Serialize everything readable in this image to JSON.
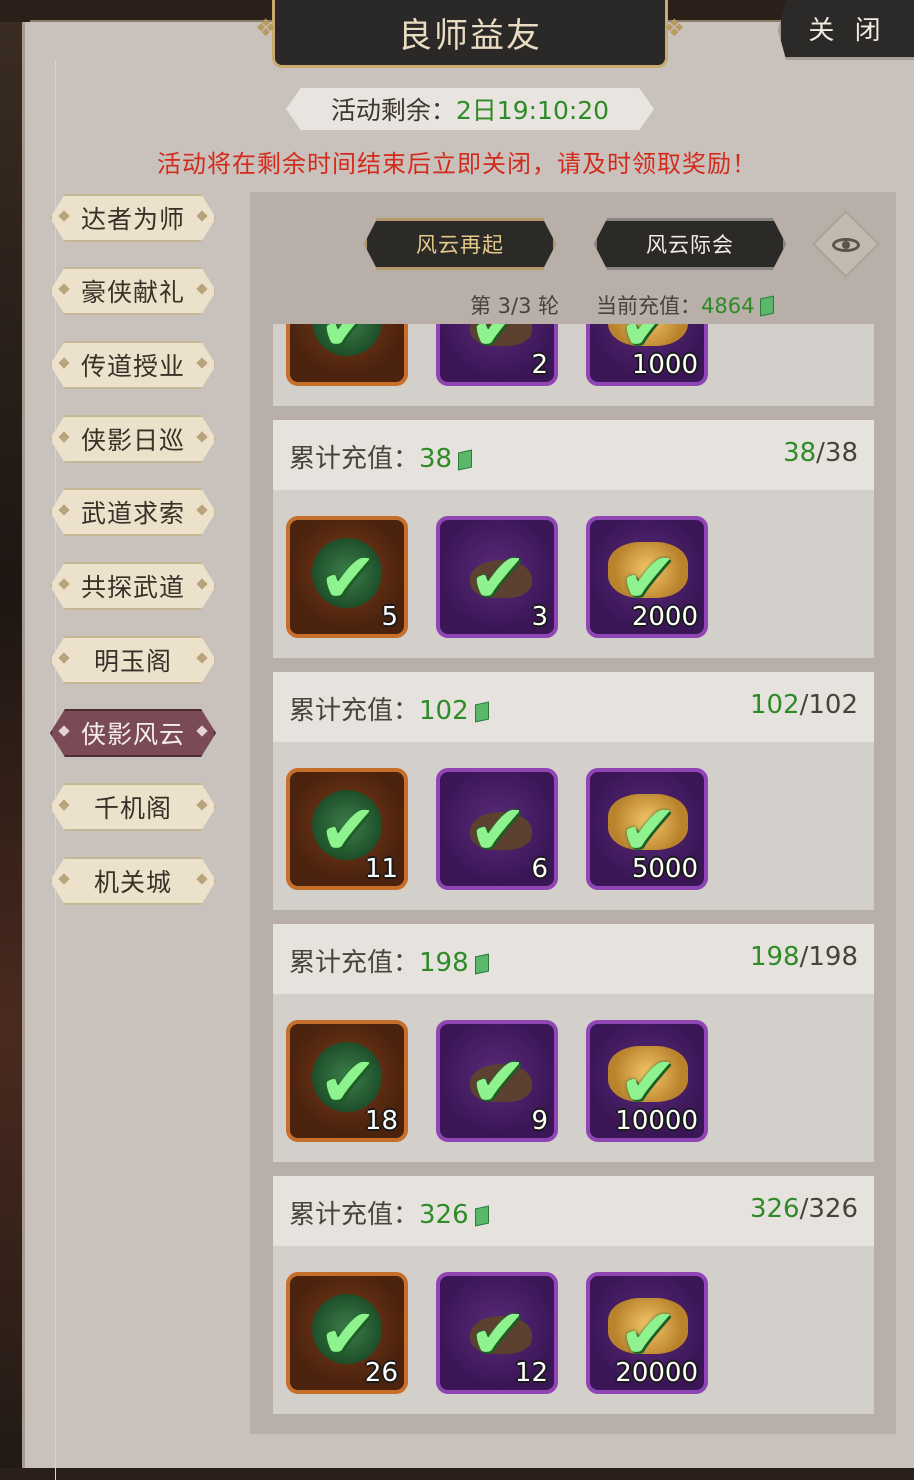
{
  "header": {
    "title": "良师益友",
    "close_label": "关 闭"
  },
  "timer": {
    "label": "活动剩余：",
    "value": "2日19:10:20"
  },
  "warning": "活动将在剩余时间结束后立即关闭，请及时领取奖励！",
  "sidebar": {
    "items": [
      {
        "label": "达者为师"
      },
      {
        "label": "豪侠献礼"
      },
      {
        "label": "传道授业"
      },
      {
        "label": "侠影日巡"
      },
      {
        "label": "武道求索"
      },
      {
        "label": "共探武道"
      },
      {
        "label": "明玉阁"
      },
      {
        "label": "侠影风云",
        "active": true
      },
      {
        "label": "千机阁"
      },
      {
        "label": "机关城"
      }
    ]
  },
  "tabs": [
    {
      "label": "风云再起",
      "active": true
    },
    {
      "label": "风云际会",
      "active": false
    }
  ],
  "status": {
    "round": "第 3/3 轮",
    "recharge_label": "当前充值：",
    "recharge_value": "4864"
  },
  "partial_tier": {
    "counts": [
      "",
      "2",
      "1000"
    ]
  },
  "tiers": [
    {
      "label": "累计充值：",
      "value": "38",
      "progress_current": "38",
      "progress_total": "/38",
      "counts": [
        "5",
        "3",
        "2000"
      ]
    },
    {
      "label": "累计充值：",
      "value": "102",
      "progress_current": "102",
      "progress_total": "/102",
      "counts": [
        "11",
        "6",
        "5000"
      ]
    },
    {
      "label": "累计充值：",
      "value": "198",
      "progress_current": "198",
      "progress_total": "/198",
      "counts": [
        "18",
        "9",
        "10000"
      ]
    },
    {
      "label": "累计充值：",
      "value": "326",
      "progress_current": "326",
      "progress_total": "/326",
      "counts": [
        "26",
        "12",
        "20000"
      ]
    }
  ],
  "icons": {
    "item_types": [
      "jade-token-icon",
      "seed-pouch-icon",
      "gold-ingot-icon"
    ],
    "claimed": "checkmark-icon",
    "currency": "jade-currency-icon",
    "view": "eye-icon"
  },
  "colors": {
    "accent_green": "#2f8a28",
    "warning_red": "#d32a1c",
    "active_tab_gold": "#e3c98a"
  }
}
